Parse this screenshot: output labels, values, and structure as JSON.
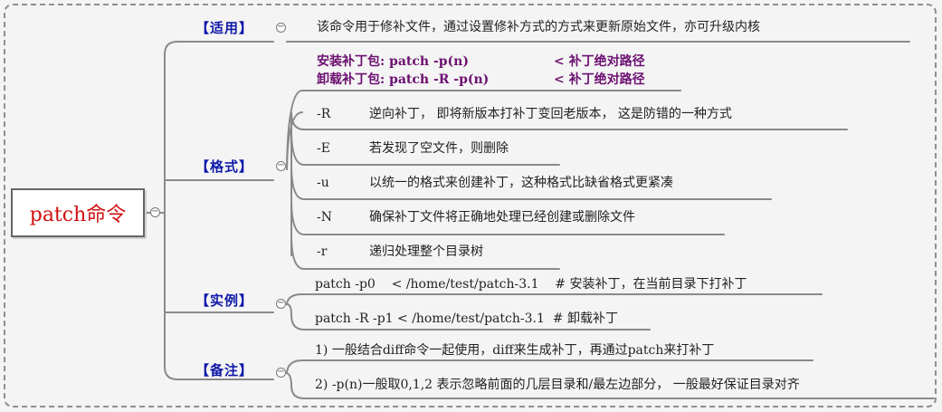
{
  "root": {
    "label": "patch命令"
  },
  "branches": {
    "apply": {
      "label": "【适用】",
      "text": "该命令用于修补文件，通过设置修补方式的方式来更新原始文件，亦可升级内核"
    },
    "format": {
      "label": "【格式】",
      "install": {
        "cmd": "安装补丁包: patch -p(n)",
        "note": "< 补丁绝对路径"
      },
      "uninstall": {
        "cmd": "卸载补丁包: patch -R -p(n)",
        "note": "< 补丁绝对路径"
      },
      "options": [
        {
          "flag": "-R",
          "desc": "逆向补丁， 即将新版本打补丁变回老版本， 这是防错的一种方式"
        },
        {
          "flag": "-E",
          "desc": "若发现了空文件，则删除"
        },
        {
          "flag": "-u",
          "desc": "以统一的格式来创建补丁，这种格式比缺省格式更紧凑"
        },
        {
          "flag": "-N",
          "desc": "确保补丁文件将正确地处理已经创建或删除文件"
        },
        {
          "flag": "-r",
          "desc": "递归处理整个目录树"
        }
      ]
    },
    "examples": {
      "label": "【实例】",
      "items": [
        "patch -p0    < /home/test/patch-3.1    # 安装补丁，在当前目录下打补丁",
        "patch -R -p1 < /home/test/patch-3.1  # 卸载补丁"
      ]
    },
    "notes": {
      "label": "【备注】",
      "items": [
        "1) 一般结合diff命令一起使用，diff来生成补丁，再通过patch来打补丁",
        "2) -p(n)一般取0,1,2 表示忽略前面的几层目录和/最左边部分， 一般最好保证目录对齐"
      ]
    }
  },
  "colors": {
    "root_text": "#d01010",
    "branch_label": "#1019a8",
    "highlight": "#6b1070",
    "line": "#8a8a8a"
  }
}
